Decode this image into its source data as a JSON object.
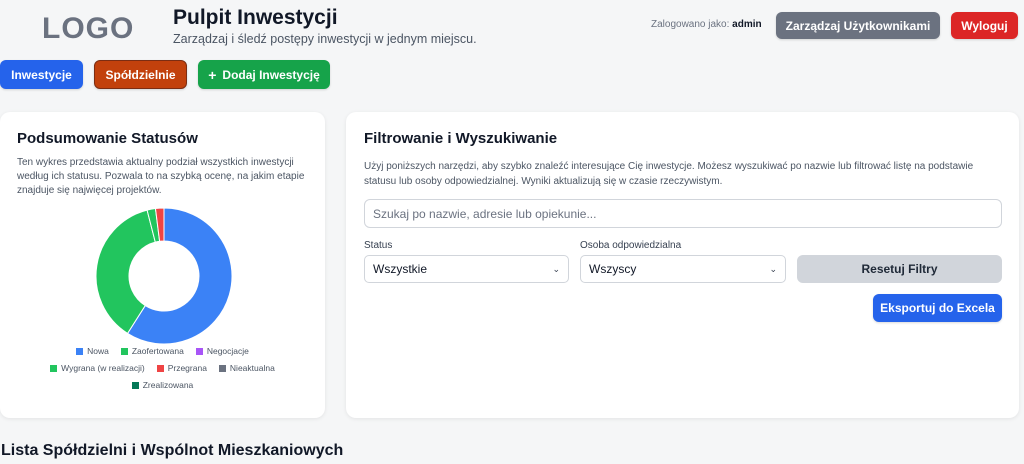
{
  "header": {
    "logo": "LOGO",
    "title": "Pulpit Inwestycji",
    "subtitle": "Zarządzaj i śledź postępy inwestycji w jednym miejscu.",
    "logged_in_label": "Zalogowano jako:",
    "username": "admin",
    "manage_users_label": "Zarządzaj Użytkownikami",
    "logout_label": "Wyloguj"
  },
  "nav": {
    "investments_label": "Inwestycje",
    "cooperatives_label": "Spółdzielnie",
    "add_investment_label": "Dodaj Inwestycję",
    "add_icon": "plus-icon"
  },
  "summary": {
    "title": "Podsumowanie Statusów",
    "description": "Ten wykres przedstawia aktualny podział wszystkich inwestycji według ich statusu. Pozwala to na szybką ocenę, na jakim etapie znajduje się najwięcej projektów."
  },
  "chart_data": {
    "type": "pie",
    "categories": [
      "Nowa",
      "Zaofertowana",
      "Negocjacje",
      "Wygrana (w realizacji)",
      "Przegrana",
      "Nieaktualna",
      "Zrealizowana"
    ],
    "values": [
      59,
      37,
      0,
      2,
      2,
      0,
      0
    ],
    "colors": [
      "#3b82f6",
      "#22c55e",
      "#a855f7",
      "#22c55e",
      "#ef4444",
      "#6b7280",
      "#047857"
    ]
  },
  "filters": {
    "title": "Filtrowanie i Wyszukiwanie",
    "description": "Użyj poniższych narzędzi, aby szybko znaleźć interesujące Cię inwestycje. Możesz wyszukiwać po nazwie lub filtrować listę na podstawie statusu lub osoby odpowiedzialnej. Wyniki aktualizują się w czasie rzeczywistym.",
    "search_placeholder": "Szukaj po nazwie, adresie lub opiekunie...",
    "search_value": "",
    "status_label": "Status",
    "status_value": "Wszystkie",
    "person_label": "Osoba odpowiedzialna",
    "person_value": "Wszyscy",
    "reset_label": "Resetuj Filtry",
    "export_label": "Eksportuj do Excela"
  },
  "list": {
    "title": "Lista Spółdzielni i Wspólnot Mieszkaniowych"
  },
  "colors": {
    "primary": "#2563eb",
    "danger": "#dc2626",
    "success": "#16a34a",
    "orange": "#c2410c",
    "gray": "#6b7280"
  }
}
